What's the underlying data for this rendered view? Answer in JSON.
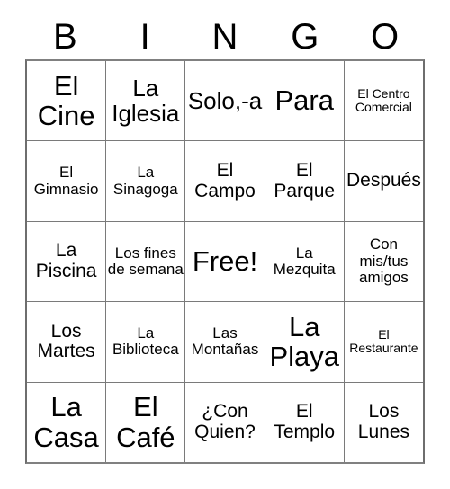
{
  "card": {
    "type": "bingo-card",
    "columns": 5,
    "rows": 5,
    "header_letters": [
      "B",
      "I",
      "N",
      "G",
      "O"
    ],
    "free_space": {
      "row": 3,
      "column": 3,
      "label": "Free!"
    },
    "colors": {
      "text": "#000000",
      "background": "#ffffff",
      "grid_line": "#7a7a7a",
      "outer_border": "#6e6e6e"
    },
    "grid": [
      [
        {
          "text": "El Cine",
          "size": "xl"
        },
        {
          "text": "La Iglesia",
          "size": "lg"
        },
        {
          "text": "Solo,-a",
          "size": "lg"
        },
        {
          "text": "Para",
          "size": "xl"
        },
        {
          "text": "El Centro Comercial",
          "size": "xs"
        }
      ],
      [
        {
          "text": "El Gimnasio",
          "size": "sm"
        },
        {
          "text": "La Sinagoga",
          "size": "sm"
        },
        {
          "text": "El Campo",
          "size": "md"
        },
        {
          "text": "El Parque",
          "size": "md"
        },
        {
          "text": "Después",
          "size": "md"
        }
      ],
      [
        {
          "text": "La Piscina",
          "size": "md"
        },
        {
          "text": "Los fines de semana",
          "size": "sm"
        },
        {
          "text": "Free!",
          "size": "xl"
        },
        {
          "text": "La Mezquita",
          "size": "sm"
        },
        {
          "text": "Con mis/tus amigos",
          "size": "sm"
        }
      ],
      [
        {
          "text": "Los Martes",
          "size": "md"
        },
        {
          "text": "La Biblioteca",
          "size": "sm"
        },
        {
          "text": "Las Montañas",
          "size": "sm"
        },
        {
          "text": "La Playa",
          "size": "xl"
        },
        {
          "text": "El Restaurante",
          "size": "xs"
        }
      ],
      [
        {
          "text": "La Casa",
          "size": "xl"
        },
        {
          "text": "El Café",
          "size": "xl"
        },
        {
          "text": "¿Con Quien?",
          "size": "md"
        },
        {
          "text": "El Templo",
          "size": "md"
        },
        {
          "text": "Los Lunes",
          "size": "md"
        }
      ]
    ]
  }
}
